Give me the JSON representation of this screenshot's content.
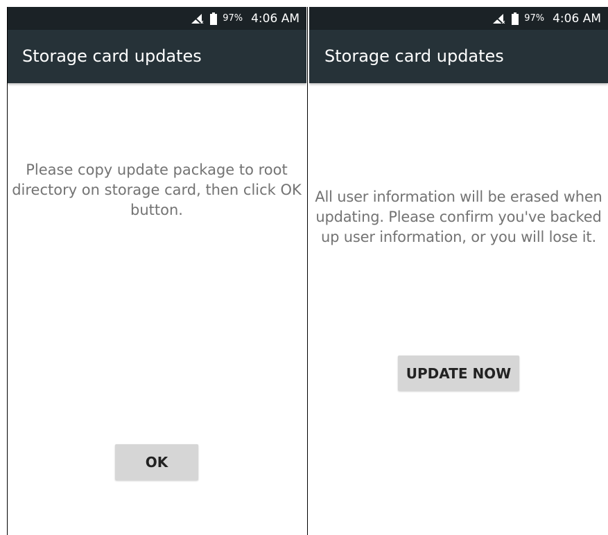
{
  "screens": [
    {
      "status_bar": {
        "battery_percent": "97%",
        "time": "4:06 AM"
      },
      "app_bar": {
        "title": "Storage card updates"
      },
      "message": "Please copy update package to root directory on storage card, then click OK button.",
      "button_label": "OK"
    },
    {
      "status_bar": {
        "battery_percent": "97%",
        "time": "4:06 AM"
      },
      "app_bar": {
        "title": "Storage card updates"
      },
      "message": "All user information will be erased when updating. Please confirm you've backed up user information, or you will lose it.",
      "button_label": "UPDATE NOW"
    }
  ],
  "colors": {
    "status_bar_bg": "#1b2226",
    "app_bar_bg": "#263238",
    "message_text": "#737373",
    "button_bg": "#d6d6d6"
  },
  "icons": {
    "signal": "no-sim-icon",
    "battery": "battery-icon"
  }
}
